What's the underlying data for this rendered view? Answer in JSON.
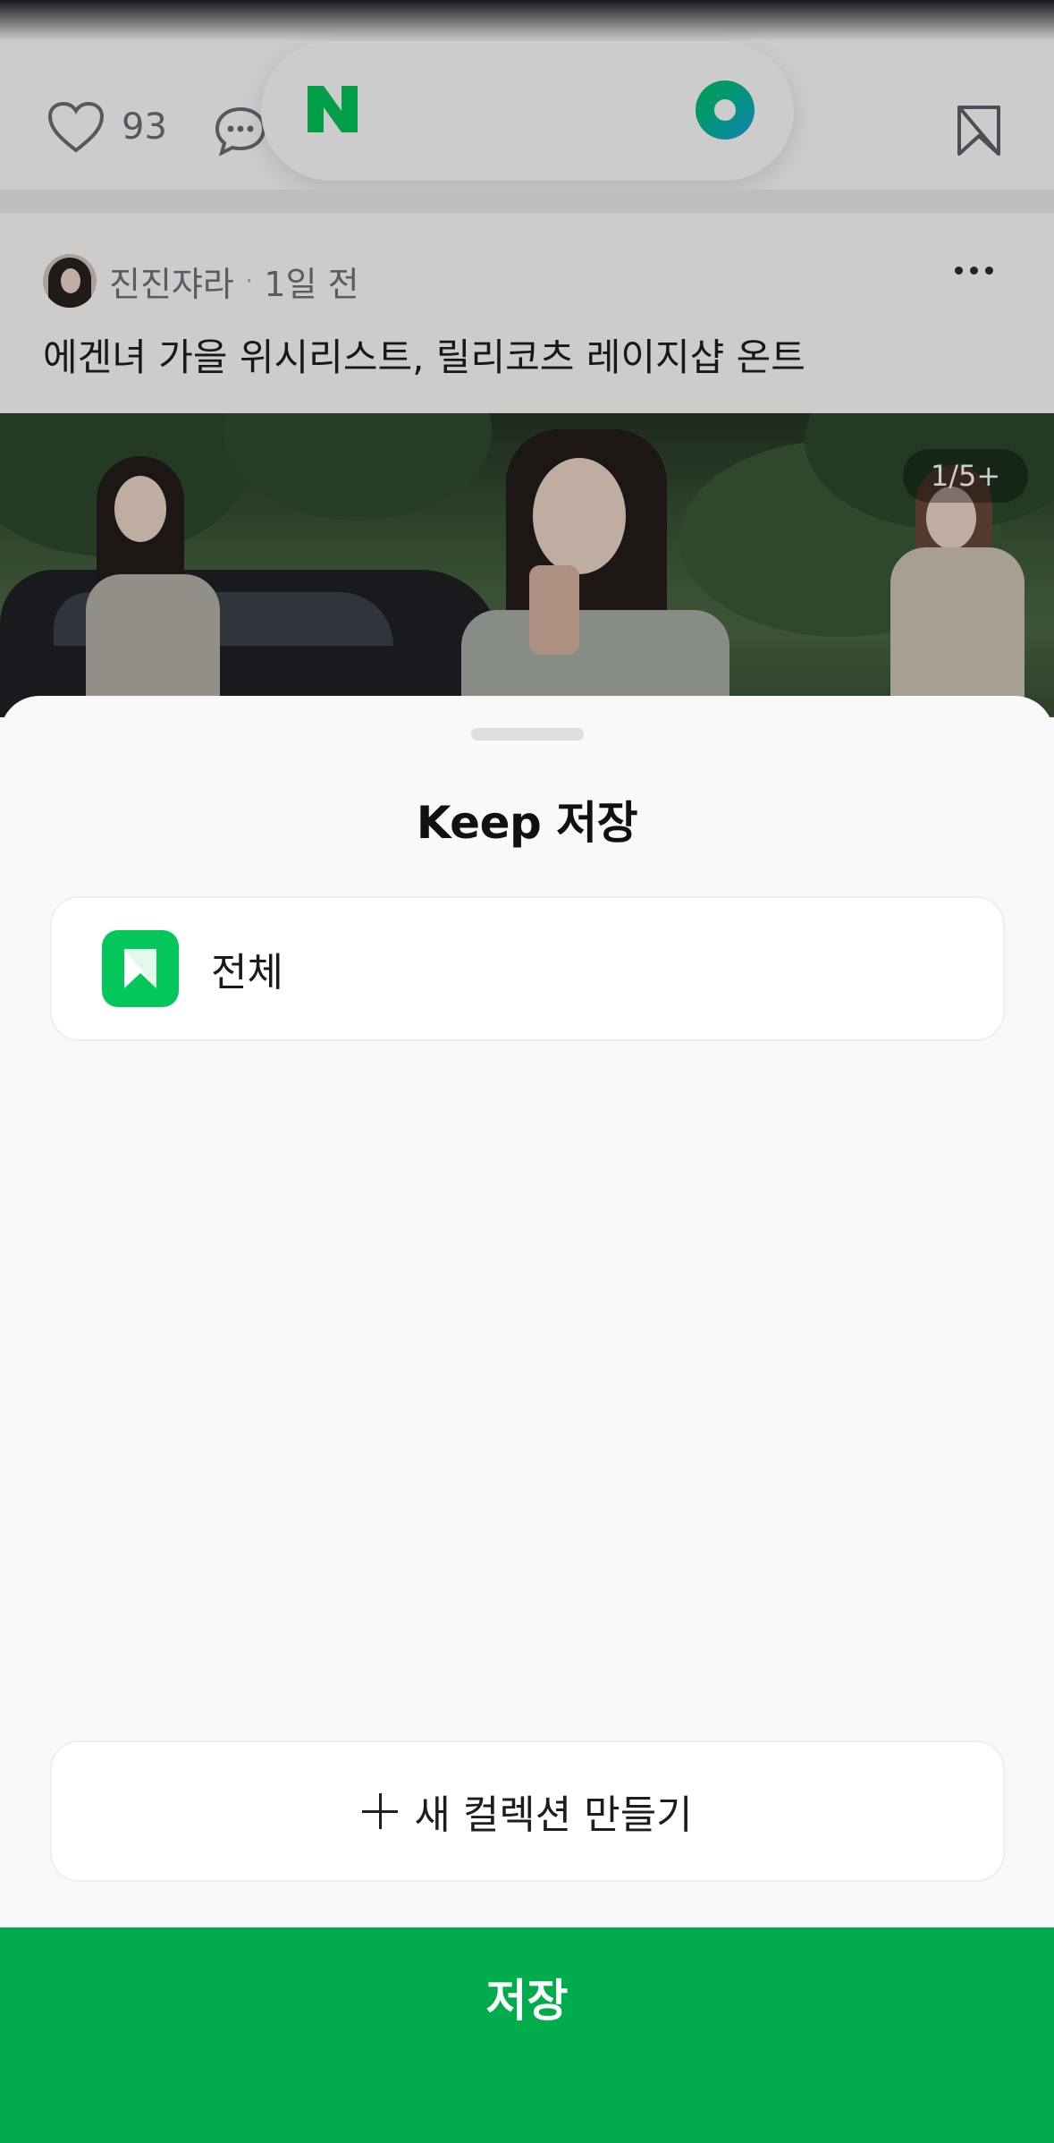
{
  "feed": {
    "like_count": "93",
    "post": {
      "author": "진진쟈라",
      "separator": "·",
      "time": "1일 전",
      "title": "에겐녀 가을 위시리스트, 릴리코츠 레이지샵 온트",
      "image_counter": "1/5+"
    },
    "naver_logo": "N"
  },
  "sheet": {
    "title": "Keep 저장",
    "collections": [
      {
        "label": "전체",
        "icon": "bookmark-icon"
      }
    ],
    "new_collection_label": "새 컬렉션 만들기",
    "save_label": "저장"
  },
  "colors": {
    "brand_green": "#03c75a",
    "save_bar": "#00ac4b"
  }
}
